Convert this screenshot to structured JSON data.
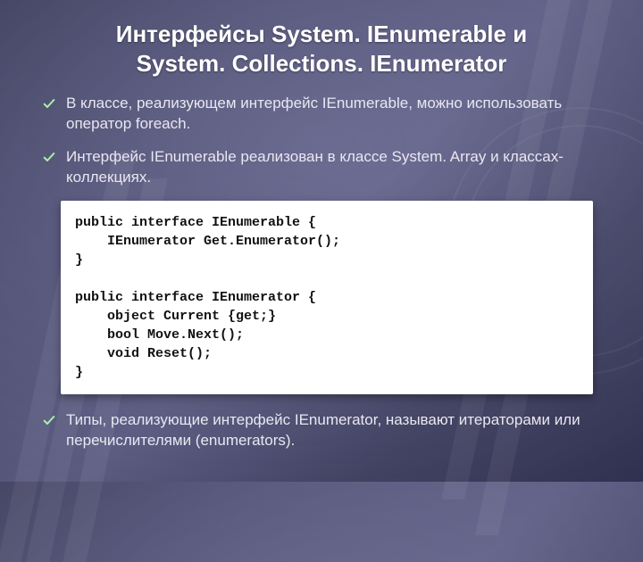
{
  "title_line1": "Интерфейсы System. IEnumerable и",
  "title_line2": "System. Collections. IEnumerator",
  "bullets": [
    "В классе,  реализующем  интерфейс  IEnumerable, можно использовать оператор foreach.",
    "Интерфейс  IEnumerable реализован в классе System. Array и классах-коллекциях.",
    "Типы, реализующие интерфейс IEnumerator, называют итераторами или перечислителями (enumerators)."
  ],
  "code": "public interface IEnumerable {\n    IEnumerator Get.Enumerator();\n}\n\npublic interface IEnumerator {\n    object Current {get;}\n    bool Move.Next();\n    void Reset();\n}"
}
